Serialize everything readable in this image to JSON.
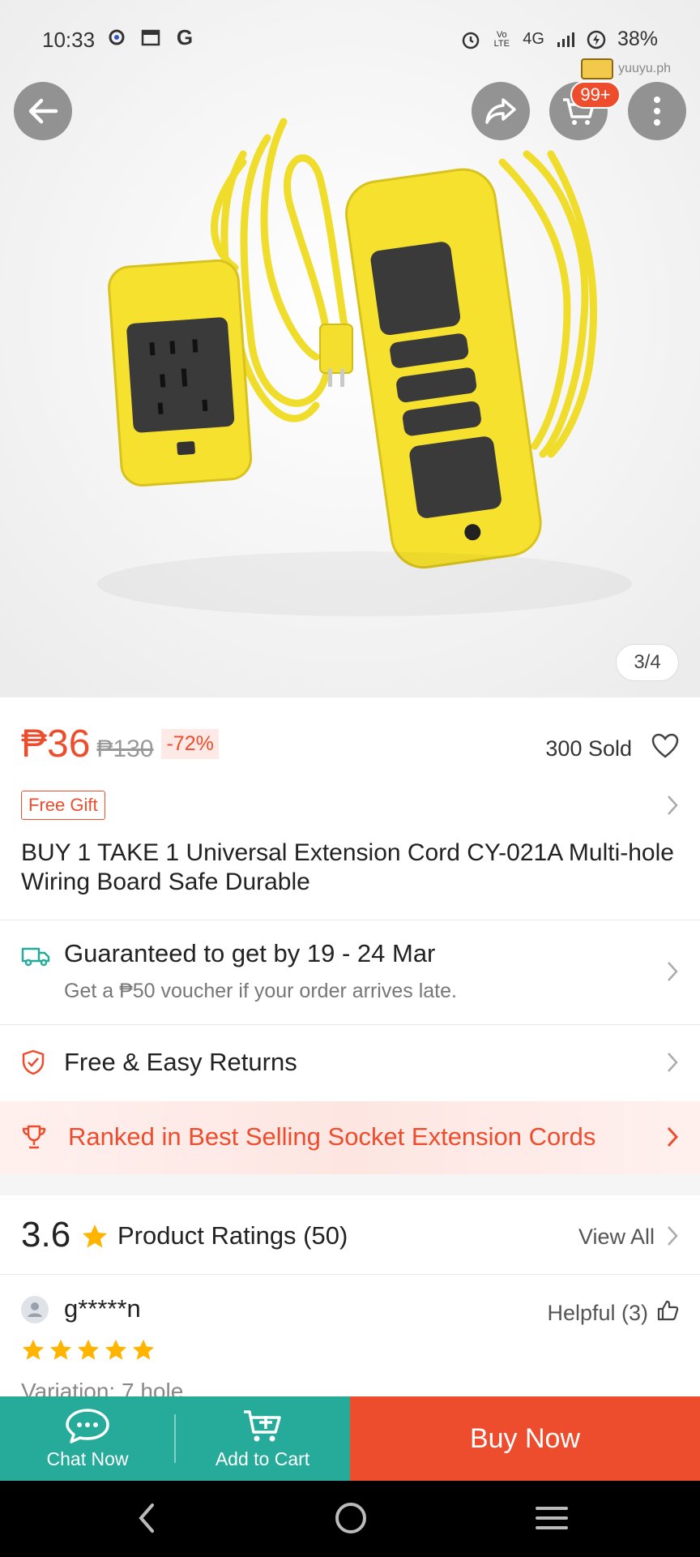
{
  "status_bar": {
    "time": "10:33",
    "network": "4G",
    "battery": "38%"
  },
  "watermark": "yuuyu.ph",
  "header": {
    "cart_badge": "99+"
  },
  "gallery": {
    "counter": "3/4"
  },
  "product": {
    "price": "₱36",
    "original_price": "₱130",
    "discount": "-72%",
    "sold": "300 Sold",
    "gift_tag": "Free Gift",
    "title": "BUY 1 TAKE 1  Universal Extension Cord CY-021A Multi-hole Wiring Board Safe Durable"
  },
  "delivery": {
    "main": "Guaranteed to get by 19 - 24 Mar",
    "sub": "Get a ₱50 voucher if your order arrives late."
  },
  "returns": {
    "label": "Free & Easy Returns"
  },
  "ranked": {
    "label": "Ranked in Best Selling Socket Extension Cords"
  },
  "ratings": {
    "score": "3.6",
    "label": "Product Ratings (50)",
    "view_all": "View All"
  },
  "review": {
    "user": "g*****n",
    "helpful": "Helpful (3)",
    "stars": 5,
    "variation": "Variation: 7 hole"
  },
  "actions": {
    "chat": "Chat Now",
    "add_to_cart": "Add to Cart",
    "buy_now": "Buy Now"
  },
  "colors": {
    "brand_orange": "#ee4d2d",
    "action_teal": "#26aa99",
    "star_yellow": "#ffb400"
  }
}
